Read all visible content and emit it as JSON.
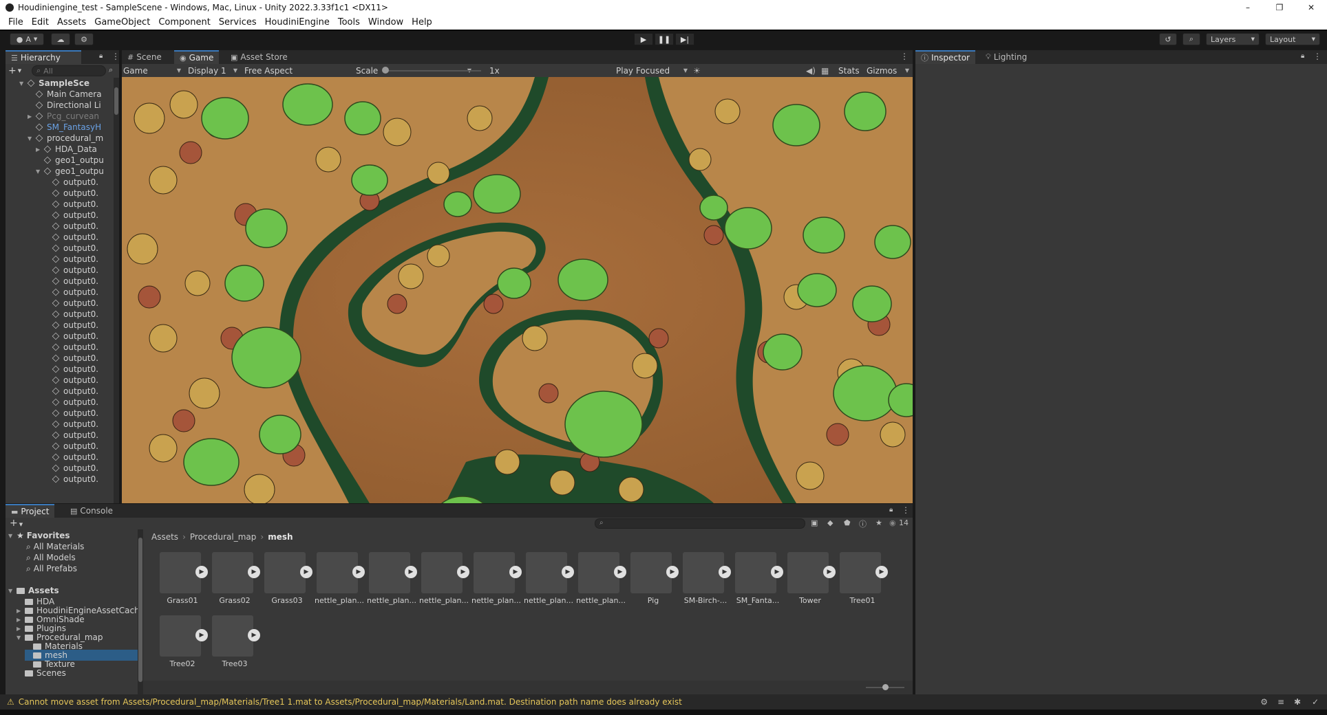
{
  "window": {
    "title": "Houdiniengine_test - SampleScene - Windows, Mac, Linux - Unity 2022.3.33f1c1 <DX11>",
    "controls": [
      "–",
      "❐",
      "✕"
    ]
  },
  "menu": [
    "File",
    "Edit",
    "Assets",
    "GameObject",
    "Component",
    "Services",
    "HoudiniEngine",
    "Tools",
    "Window",
    "Help"
  ],
  "toolbar": {
    "account_label": "A",
    "layers_label": "Layers",
    "layout_label": "Layout"
  },
  "hierarchy": {
    "tab_label": "Hierarchy",
    "search_placeholder": "All",
    "rows": [
      {
        "label": "SampleSce",
        "indent": 0,
        "arrow": "▼",
        "bold": true
      },
      {
        "label": "Main Camera",
        "indent": 1,
        "arrow": ""
      },
      {
        "label": "Directional Li",
        "indent": 1,
        "arrow": ""
      },
      {
        "label": "Pcg_curvean",
        "indent": 1,
        "arrow": "▶",
        "dim": true
      },
      {
        "label": "SM_FantasyH",
        "indent": 1,
        "arrow": "",
        "blue": true
      },
      {
        "label": "procedural_m",
        "indent": 1,
        "arrow": "▼"
      },
      {
        "label": "HDA_Data",
        "indent": 2,
        "arrow": "▶"
      },
      {
        "label": "geo1_outpu",
        "indent": 2,
        "arrow": ""
      },
      {
        "label": "geo1_outpu",
        "indent": 2,
        "arrow": "▼"
      },
      {
        "label": "output0.",
        "indent": 3,
        "arrow": ""
      },
      {
        "label": "output0.",
        "indent": 3,
        "arrow": ""
      },
      {
        "label": "output0.",
        "indent": 3,
        "arrow": ""
      },
      {
        "label": "output0.",
        "indent": 3,
        "arrow": ""
      },
      {
        "label": "output0.",
        "indent": 3,
        "arrow": ""
      },
      {
        "label": "output0.",
        "indent": 3,
        "arrow": ""
      },
      {
        "label": "output0.",
        "indent": 3,
        "arrow": ""
      },
      {
        "label": "output0.",
        "indent": 3,
        "arrow": ""
      },
      {
        "label": "output0.",
        "indent": 3,
        "arrow": ""
      },
      {
        "label": "output0.",
        "indent": 3,
        "arrow": ""
      },
      {
        "label": "output0.",
        "indent": 3,
        "arrow": ""
      },
      {
        "label": "output0.",
        "indent": 3,
        "arrow": ""
      },
      {
        "label": "output0.",
        "indent": 3,
        "arrow": ""
      },
      {
        "label": "output0.",
        "indent": 3,
        "arrow": ""
      },
      {
        "label": "output0.",
        "indent": 3,
        "arrow": ""
      },
      {
        "label": "output0.",
        "indent": 3,
        "arrow": ""
      },
      {
        "label": "output0.",
        "indent": 3,
        "arrow": ""
      },
      {
        "label": "output0.",
        "indent": 3,
        "arrow": ""
      },
      {
        "label": "output0.",
        "indent": 3,
        "arrow": ""
      },
      {
        "label": "output0.",
        "indent": 3,
        "arrow": ""
      },
      {
        "label": "output0.",
        "indent": 3,
        "arrow": ""
      },
      {
        "label": "output0.",
        "indent": 3,
        "arrow": ""
      },
      {
        "label": "output0.",
        "indent": 3,
        "arrow": ""
      },
      {
        "label": "output0.",
        "indent": 3,
        "arrow": ""
      },
      {
        "label": "output0.",
        "indent": 3,
        "arrow": ""
      },
      {
        "label": "output0.",
        "indent": 3,
        "arrow": ""
      },
      {
        "label": "output0.",
        "indent": 3,
        "arrow": ""
      },
      {
        "label": "output0.",
        "indent": 3,
        "arrow": ""
      }
    ]
  },
  "center_tabs": [
    "Scene",
    "Game",
    "Asset Store"
  ],
  "game_bar": {
    "mode": "Game",
    "display": "Display 1",
    "aspect": "Free Aspect",
    "scale_label": "Scale",
    "scale_value": "1x",
    "play_mode": "Play Focused",
    "stats_label": "Stats",
    "gizmos_label": "Gizmos"
  },
  "right_tabs": [
    "Inspector",
    "Lighting"
  ],
  "project": {
    "tabs": [
      "Project",
      "Console"
    ],
    "item_count": "14",
    "breadcrumb": [
      "Assets",
      "Procedural_map",
      "mesh"
    ],
    "favorites_label": "Favorites",
    "favorites": [
      "All Materials",
      "All Models",
      "All Prefabs"
    ],
    "assets_label": "Assets",
    "folders": [
      {
        "label": "HDA",
        "indent": 1,
        "arrow": ""
      },
      {
        "label": "HoudiniEngineAssetCache",
        "indent": 1,
        "arrow": "▶"
      },
      {
        "label": "OmniShade",
        "indent": 1,
        "arrow": "▶"
      },
      {
        "label": "Plugins",
        "indent": 1,
        "arrow": "▶"
      },
      {
        "label": "Procedural_map",
        "indent": 1,
        "arrow": "▼"
      },
      {
        "label": "Materials",
        "indent": 2,
        "arrow": ""
      },
      {
        "label": "mesh",
        "indent": 2,
        "arrow": "",
        "selected": true
      },
      {
        "label": "Texture",
        "indent": 2,
        "arrow": ""
      },
      {
        "label": "Scenes",
        "indent": 1,
        "arrow": ""
      }
    ],
    "assets": [
      "Grass01",
      "Grass02",
      "Grass03",
      "nettle_plan...",
      "nettle_plan...",
      "nettle_plan...",
      "nettle_plan...",
      "nettle_plan...",
      "nettle_plan...",
      "Pig",
      "SM-Birch-...",
      "SM_Fanta...",
      "Tower",
      "Tree01",
      "Tree02",
      "Tree03"
    ]
  },
  "status": {
    "message": "Cannot move asset from Assets/Procedural_map/Materials/Tree1 1.mat to Assets/Procedural_map/Materials/Land.mat. Destination path name does already exist"
  }
}
